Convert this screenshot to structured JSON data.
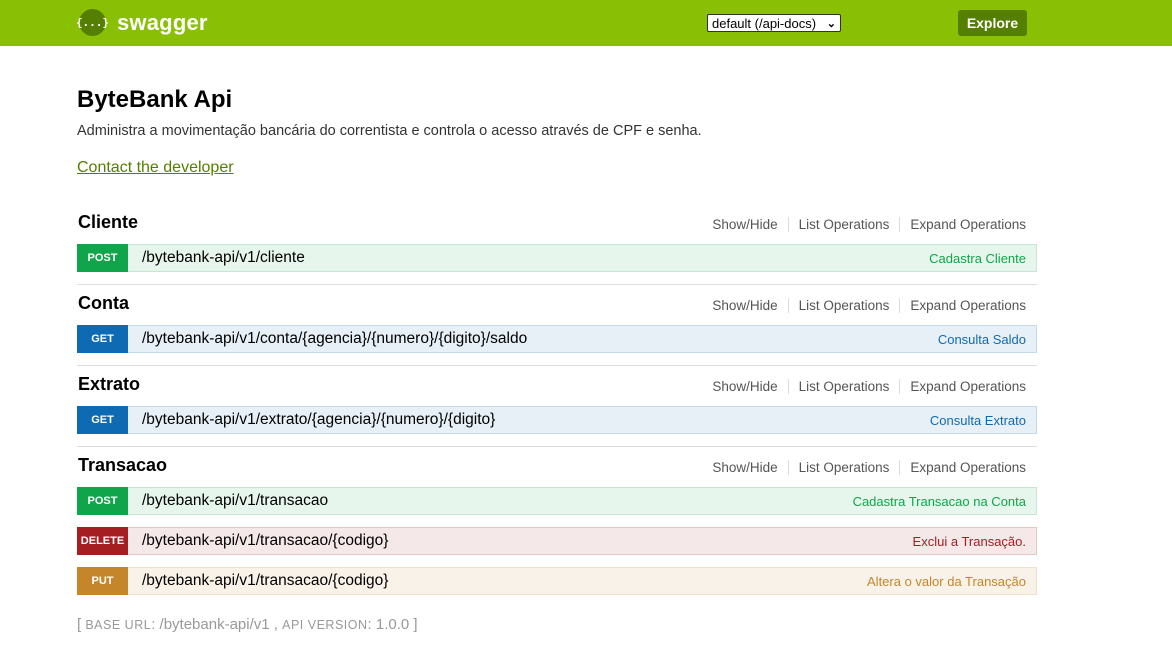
{
  "header": {
    "logo_symbol": "{...}",
    "logo_text": "swagger",
    "spec_select": "default (/api-docs)",
    "explore_label": "Explore",
    "colors": {
      "bar": "#89bf04",
      "accent": "#547f00"
    }
  },
  "info": {
    "title": "ByteBank Api",
    "description": "Administra a movimentação bancária do correntista e controla o acesso através de CPF e senha.",
    "contact": "Contact the developer"
  },
  "resource_links": {
    "show_hide": "Show/Hide",
    "list": "List Operations",
    "expand": "Expand Operations"
  },
  "resources": [
    {
      "name": "Cliente",
      "ops": [
        {
          "method": "POST",
          "path": "/bytebank-api/v1/cliente",
          "summary": "Cadastra Cliente"
        }
      ]
    },
    {
      "name": "Conta",
      "ops": [
        {
          "method": "GET",
          "path": "/bytebank-api/v1/conta/{agencia}/{numero}/{digito}/saldo",
          "summary": "Consulta Saldo"
        }
      ]
    },
    {
      "name": "Extrato",
      "ops": [
        {
          "method": "GET",
          "path": "/bytebank-api/v1/extrato/{agencia}/{numero}/{digito}",
          "summary": "Consulta Extrato"
        }
      ]
    },
    {
      "name": "Transacao",
      "ops": [
        {
          "method": "POST",
          "path": "/bytebank-api/v1/transacao",
          "summary": "Cadastra Transacao na Conta"
        },
        {
          "method": "DELETE",
          "path": "/bytebank-api/v1/transacao/{codigo}",
          "summary": "Exclui a Transação."
        },
        {
          "method": "PUT",
          "path": "/bytebank-api/v1/transacao/{codigo}",
          "summary": "Altera o valor da Transação"
        }
      ]
    }
  ],
  "footer": {
    "open": "[",
    "base_url_label": "BASE URL",
    "base_url": "/bytebank-api/v1",
    "api_version_label": "API VERSION",
    "api_version": "1.0.0",
    "close": "]"
  }
}
